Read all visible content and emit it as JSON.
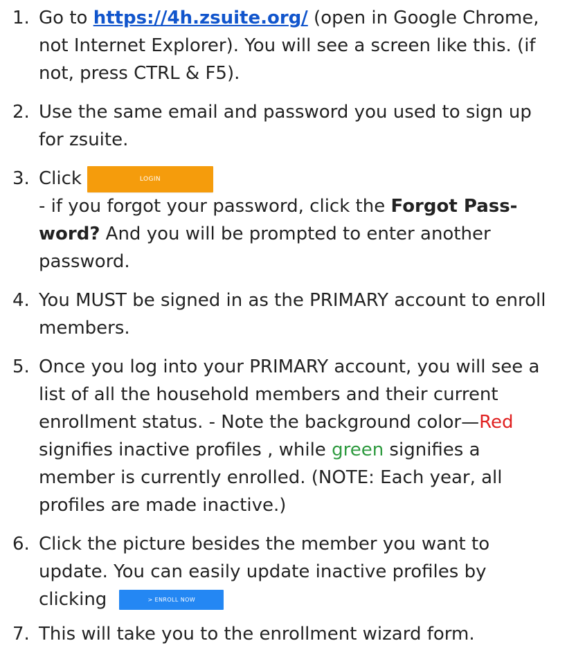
{
  "steps": [
    {
      "number": "1.",
      "lead": "Go to ",
      "link": "https://4h.zsuite.org/",
      "rest": " (open in Google Chrome, not Internet Explorer). You will see a screen like this. (if not, press CTRL & F5)."
    },
    {
      "number": "2.",
      "text": "Use the same email and password you used to sign up for zsuite."
    },
    {
      "number": "3.",
      "click_label": "Click",
      "button_label": "LOGIN",
      "sub_lead": " - if you forgot your password, click the ",
      "sub_bold": "Forgot Pass-word?",
      "sub_rest": " And you will be prompted to enter another password."
    },
    {
      "number": "4.",
      "text": "You MUST be signed in as the PRIMARY account to enroll members."
    },
    {
      "number": "5.",
      "part1": "Once you log into your PRIMARY account, you will see a list of all the household members and their current enrollment status. - Note the background color—",
      "red_word": "Red",
      "part2": " signifies inactive profiles , while ",
      "green_word": "green",
      "part3": " signifies a member is currently enrolled. (NOTE: Each year, all profiles are made inactive.)"
    },
    {
      "number": "6.",
      "text": "Click the picture besides the member you want to update. You can easily update inactive profiles by clicking",
      "button_label": "> ENROLL NOW"
    },
    {
      "number": "7.",
      "text": "This will take you to the enrollment wizard form."
    }
  ],
  "colors": {
    "link": "#1155cc",
    "login_button": "#f59c0c",
    "enroll_button": "#2487f3",
    "red": "#e02020",
    "green": "#2e9a3f"
  }
}
